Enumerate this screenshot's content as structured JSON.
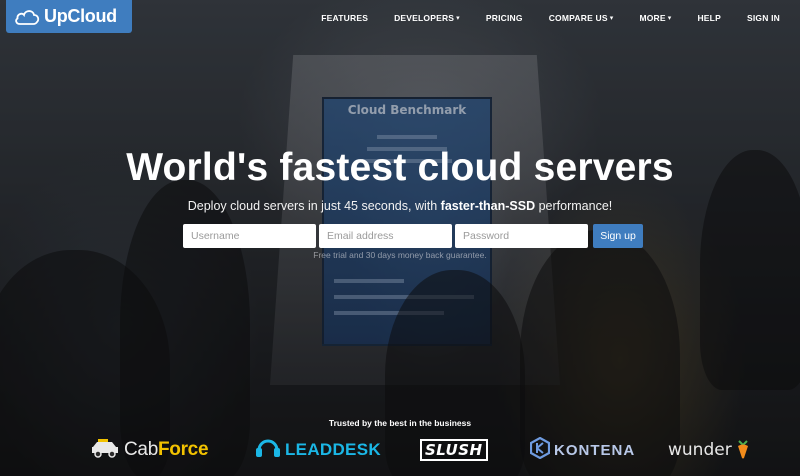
{
  "brand": {
    "name": "UpCloud",
    "logo_icon": "cloud-icon",
    "accent": "#3f7dbf"
  },
  "nav": {
    "items": [
      {
        "label": "FEATURES",
        "dropdown": false
      },
      {
        "label": "DEVELOPERS",
        "dropdown": true
      },
      {
        "label": "PRICING",
        "dropdown": false
      },
      {
        "label": "COMPARE US",
        "dropdown": true
      },
      {
        "label": "MORE",
        "dropdown": true
      },
      {
        "label": "HELP",
        "dropdown": false
      },
      {
        "label": "SIGN IN",
        "dropdown": false
      }
    ]
  },
  "hero": {
    "title": "World's fastest cloud servers",
    "subtitle_pre": "Deploy cloud servers in just 45 seconds, with ",
    "subtitle_bold": "faster-than-SSD",
    "subtitle_post": " performance!",
    "backdrop_screen_title": "Cloud Benchmark"
  },
  "signup_form": {
    "username_placeholder": "Username",
    "email_placeholder": "Email address",
    "password_placeholder": "Password",
    "submit_label": "Sign up",
    "note": "Free trial and 30 days money back guarantee."
  },
  "trusted": {
    "heading": "Trusted by the best in the business",
    "partners": {
      "cabforce": {
        "part1": "Cab",
        "part2": "Force"
      },
      "leaddesk": "LEADDESK",
      "slush": "SLUSH",
      "kontena": "KONTENA",
      "wunder": "wunder"
    }
  }
}
